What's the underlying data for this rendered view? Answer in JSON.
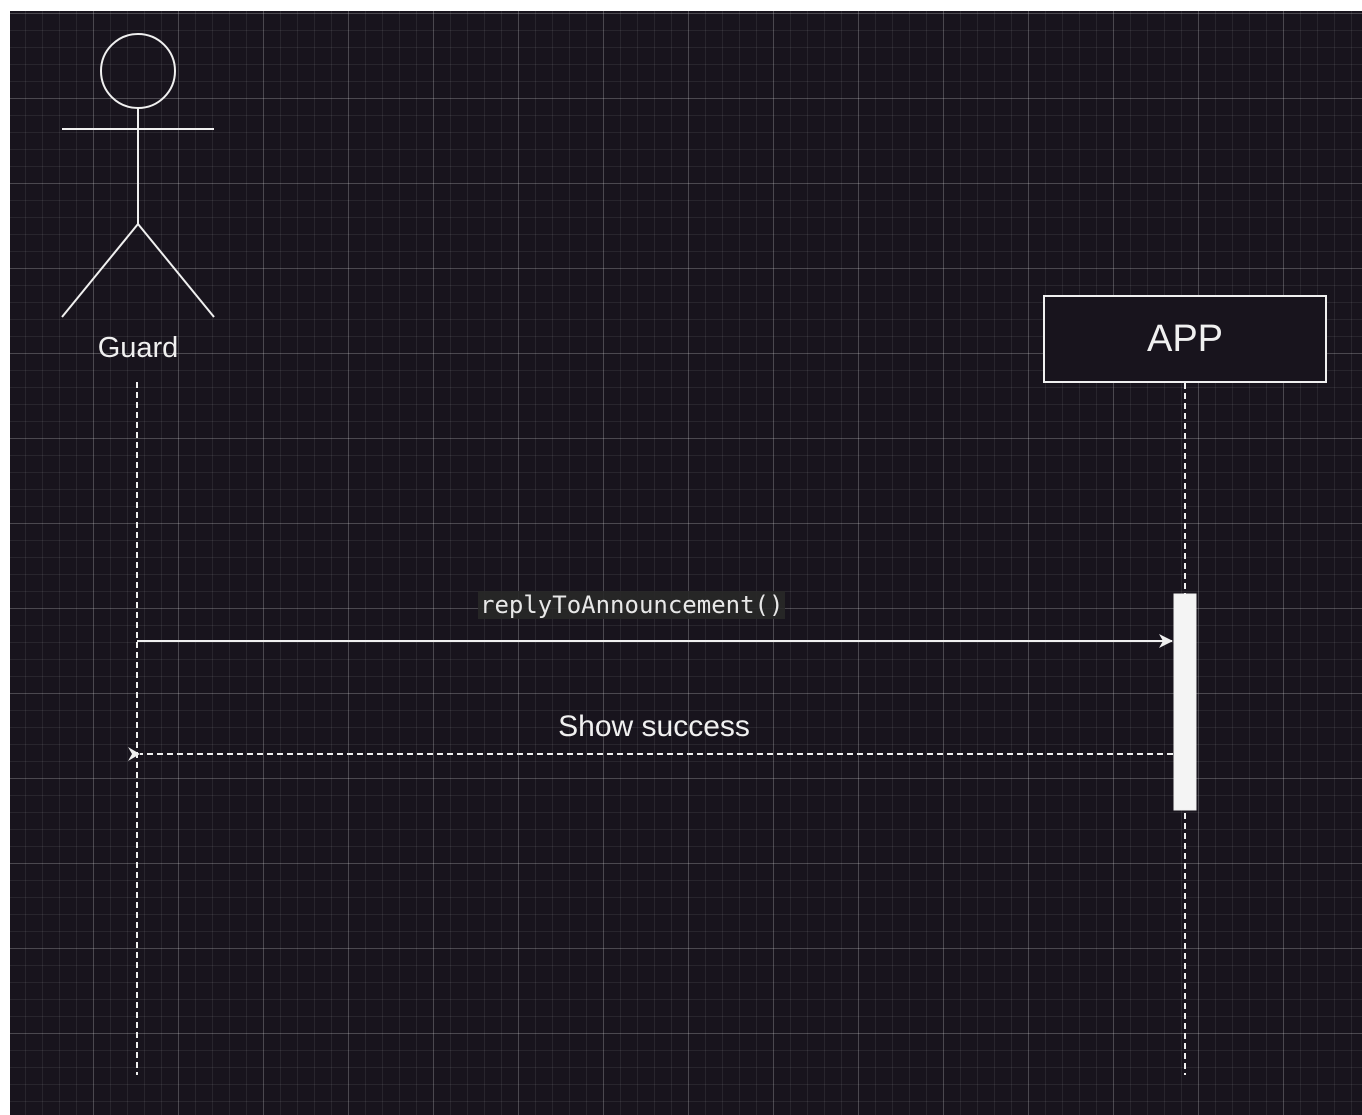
{
  "actor": {
    "label": "Guard"
  },
  "participant": {
    "label": "APP"
  },
  "messages": [
    {
      "label": "replyToAnnouncement()",
      "kind": "sync"
    },
    {
      "label": "Show success",
      "kind": "return"
    }
  ],
  "colors": {
    "background": "#18141d",
    "stroke": "#f0f0f0",
    "grid": "#3a3640"
  }
}
